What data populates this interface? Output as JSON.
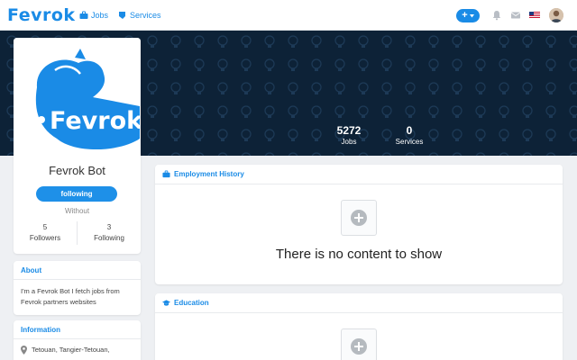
{
  "app": {
    "logo_text": "Fevrok",
    "brand_color": "#1a8be6"
  },
  "nav": {
    "jobs_label": "Jobs",
    "services_label": "Services",
    "add_label": "+"
  },
  "cover": {
    "jobs_count": "5272",
    "jobs_label": "Jobs",
    "services_count": "0",
    "services_label": "Services"
  },
  "profile": {
    "logo_text": "Fevrok",
    "name": "Fevrok Bot",
    "follow_label": "following",
    "without_label": "Without",
    "followers_count": "5",
    "followers_label": "Followers",
    "following_count": "3",
    "following_label": "Following"
  },
  "about": {
    "title": "About",
    "text": "I'm a Fevrok Bot I fetch jobs from Fevrok partners websites"
  },
  "information": {
    "title": "Information",
    "location": "Tetouan, Tangier-Tetouan,"
  },
  "employment": {
    "title": "Employment History",
    "empty_text": "There is no content to show"
  },
  "education": {
    "title": "Education"
  }
}
